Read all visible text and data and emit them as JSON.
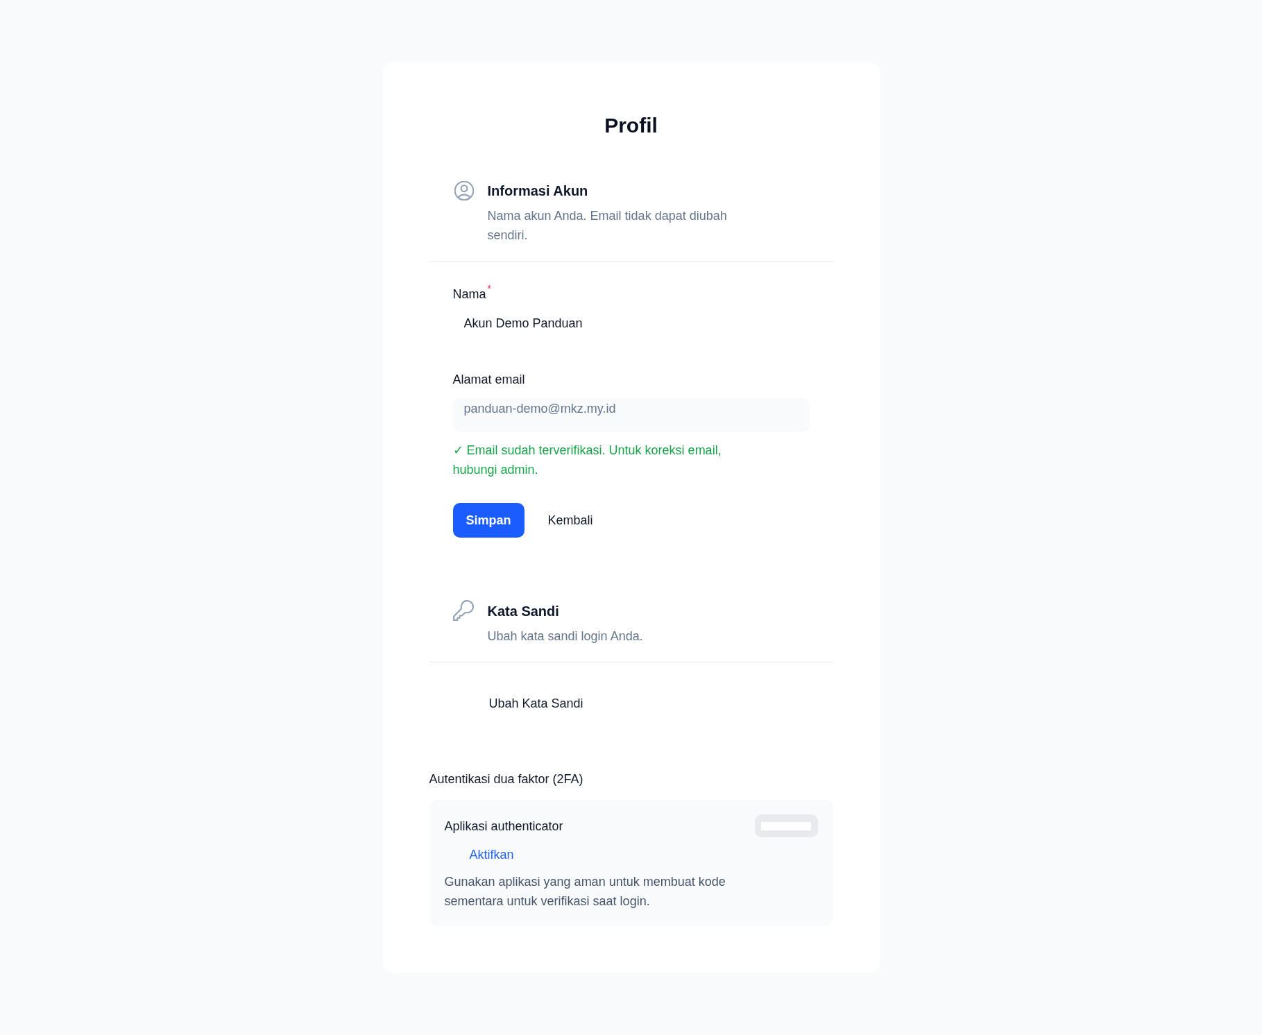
{
  "page": {
    "title": "Profil"
  },
  "sections": [
    {
      "kind": "account",
      "heading": "Informasi Akun",
      "description": "Nama akun Anda. Email tidak dapat diubah sendiri.",
      "fields": [
        {
          "label": "Nama",
          "required_mark": "*",
          "value": "Akun Demo Panduan",
          "disabled": false
        },
        {
          "label": "Alamat email",
          "value": "panduan-demo@mkz.my.id",
          "disabled": true
        }
      ],
      "note": "✓ Email sudah terverifikasi. Untuk koreksi email, hubungi admin.",
      "buttons": [
        {
          "label": "Simpan",
          "kind": "primary"
        },
        {
          "label": "Kembali",
          "kind": "plain"
        }
      ]
    },
    {
      "kind": "password",
      "heading": "Kata Sandi",
      "description": "Ubah kata sandi login Anda.",
      "action": "Ubah Kata Sandi"
    }
  ],
  "two_factor": {
    "title": "Autentikasi dua faktor (2FA)",
    "method": {
      "name": "Aplikasi authenticator",
      "action": "Aktifkan",
      "description": "Gunakan aplikasi yang aman untuk membuat kode sementara untuk verifikasi saat login."
    }
  }
}
